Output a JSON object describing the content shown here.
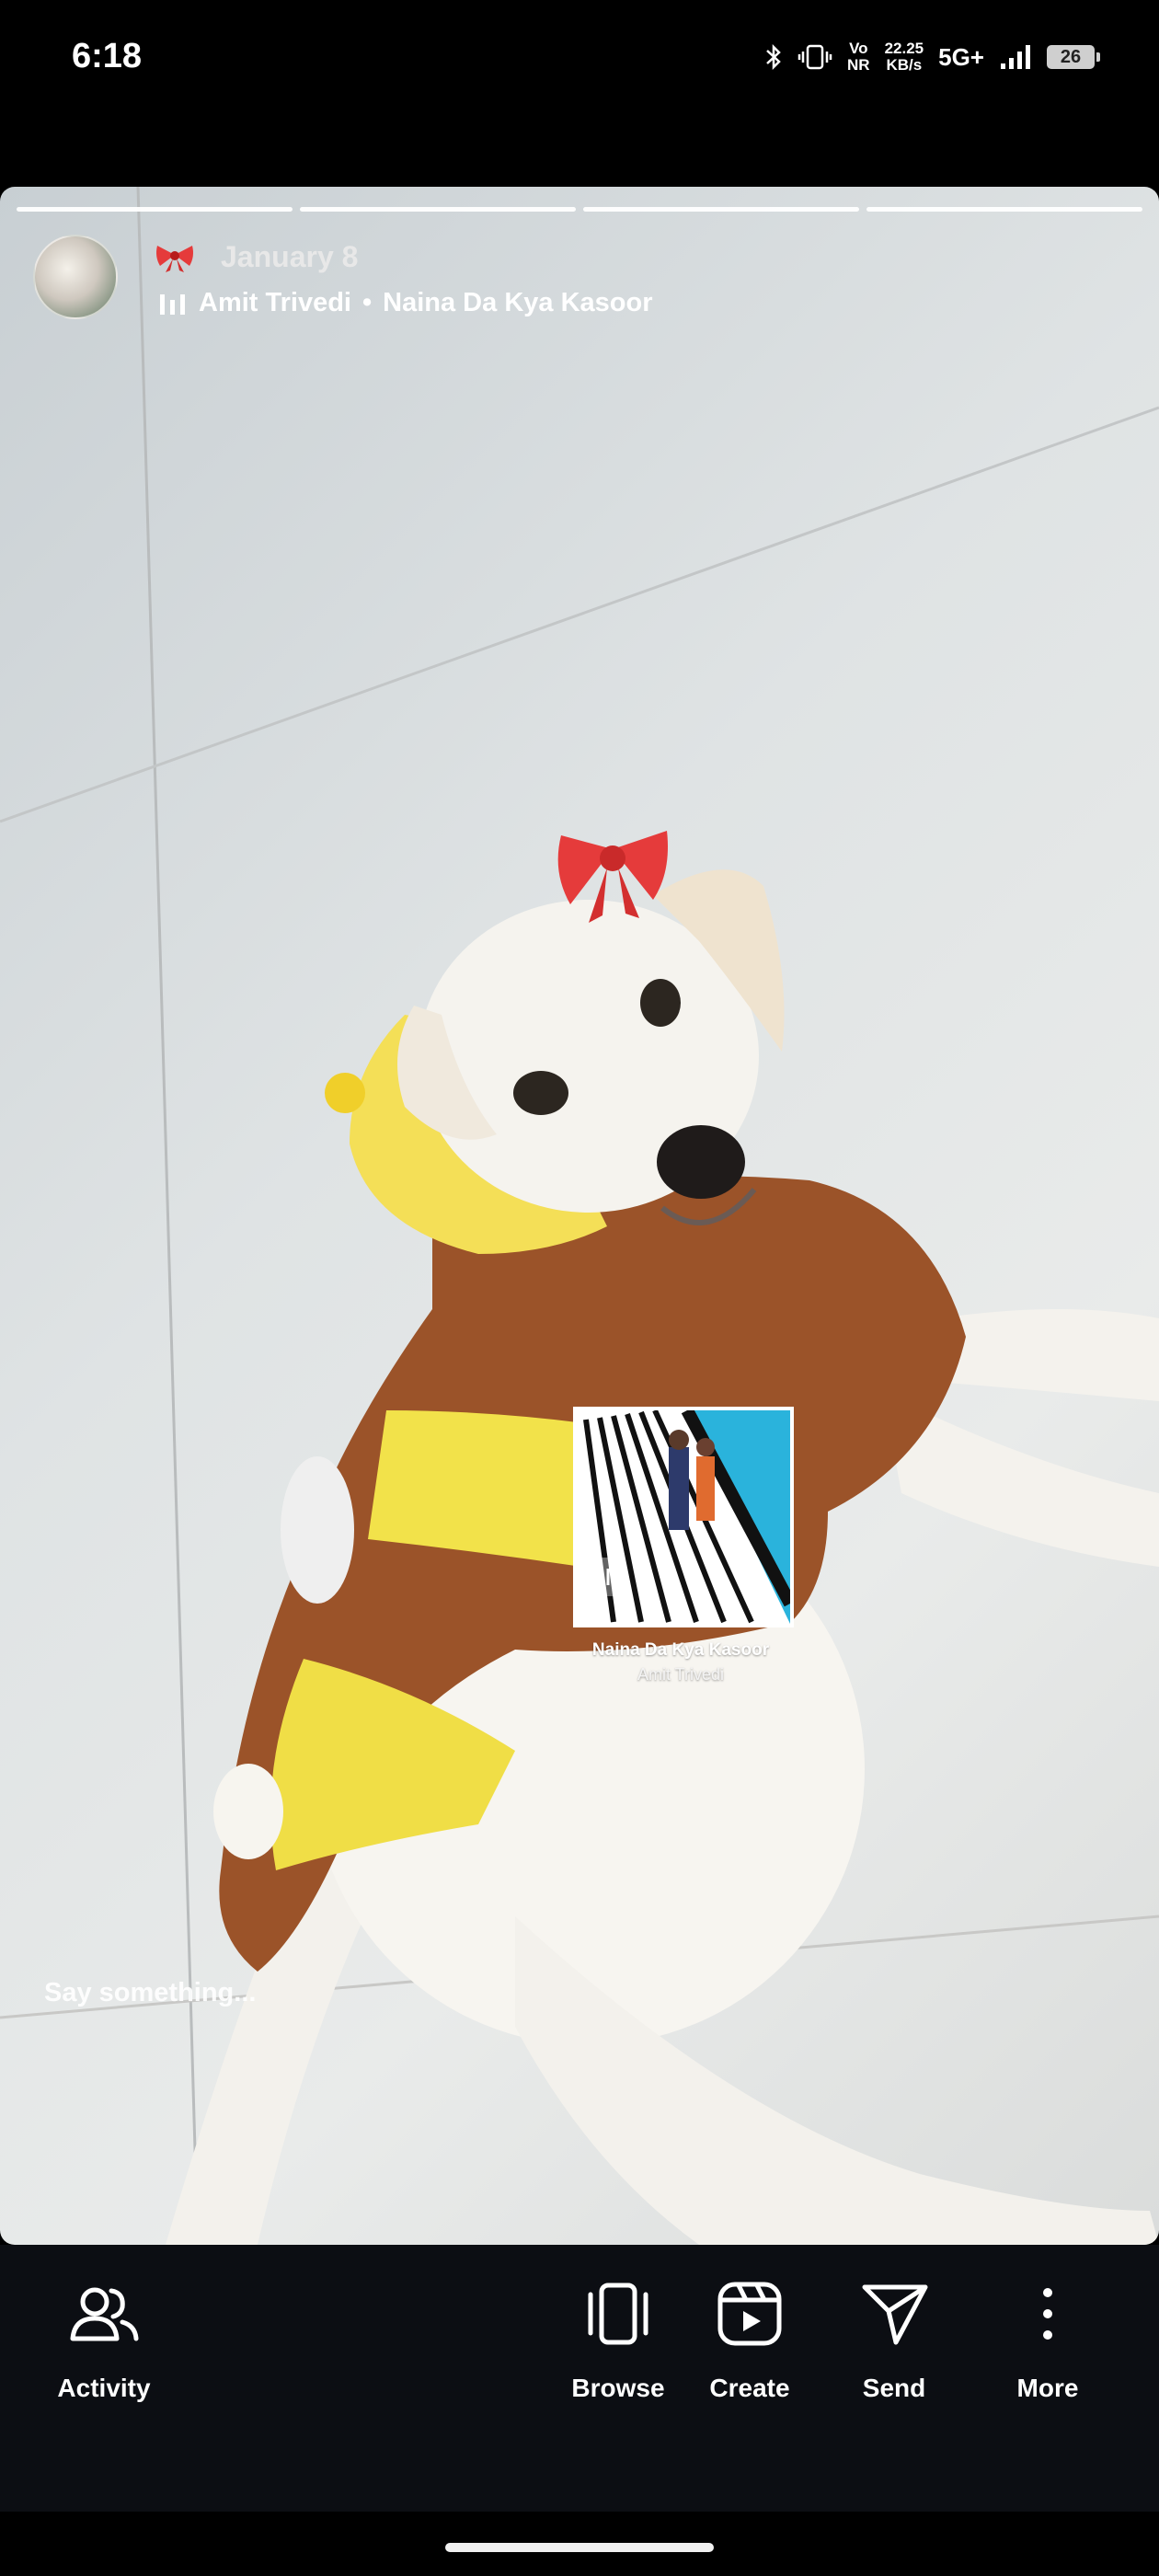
{
  "status_bar": {
    "time": "6:18",
    "net_speed_value": "22.25",
    "net_speed_unit": "KB/s",
    "volte_top": "Vo",
    "volte_bottom": "NR",
    "network": "5G+",
    "battery": "26",
    "icons": [
      "bluetooth-icon",
      "vibrate-icon",
      "signal-icon",
      "battery-icon"
    ]
  },
  "story": {
    "progress_segments": 4,
    "date": "January 8",
    "music": {
      "artist": "Amit Trivedi",
      "separator": "•",
      "song": "Naina Da Kya Kasoor"
    },
    "sticker": {
      "title": "Naina Da Kya Kasoor",
      "artist": "Amit Trivedi"
    },
    "reply_placeholder": "Say something..."
  },
  "bottom_nav": {
    "items": [
      {
        "label": "Activity",
        "icon": "people-icon"
      },
      {
        "label": "Browse",
        "icon": "browse-icon"
      },
      {
        "label": "Create",
        "icon": "create-reel-icon"
      },
      {
        "label": "Send",
        "icon": "send-icon"
      },
      {
        "label": "More",
        "icon": "more-icon"
      }
    ]
  },
  "colors": {
    "background": "#000000",
    "bottom_bar": "#0c0e13",
    "bow": "#e53b3b",
    "sticker_blue": "#2ab3dc"
  }
}
